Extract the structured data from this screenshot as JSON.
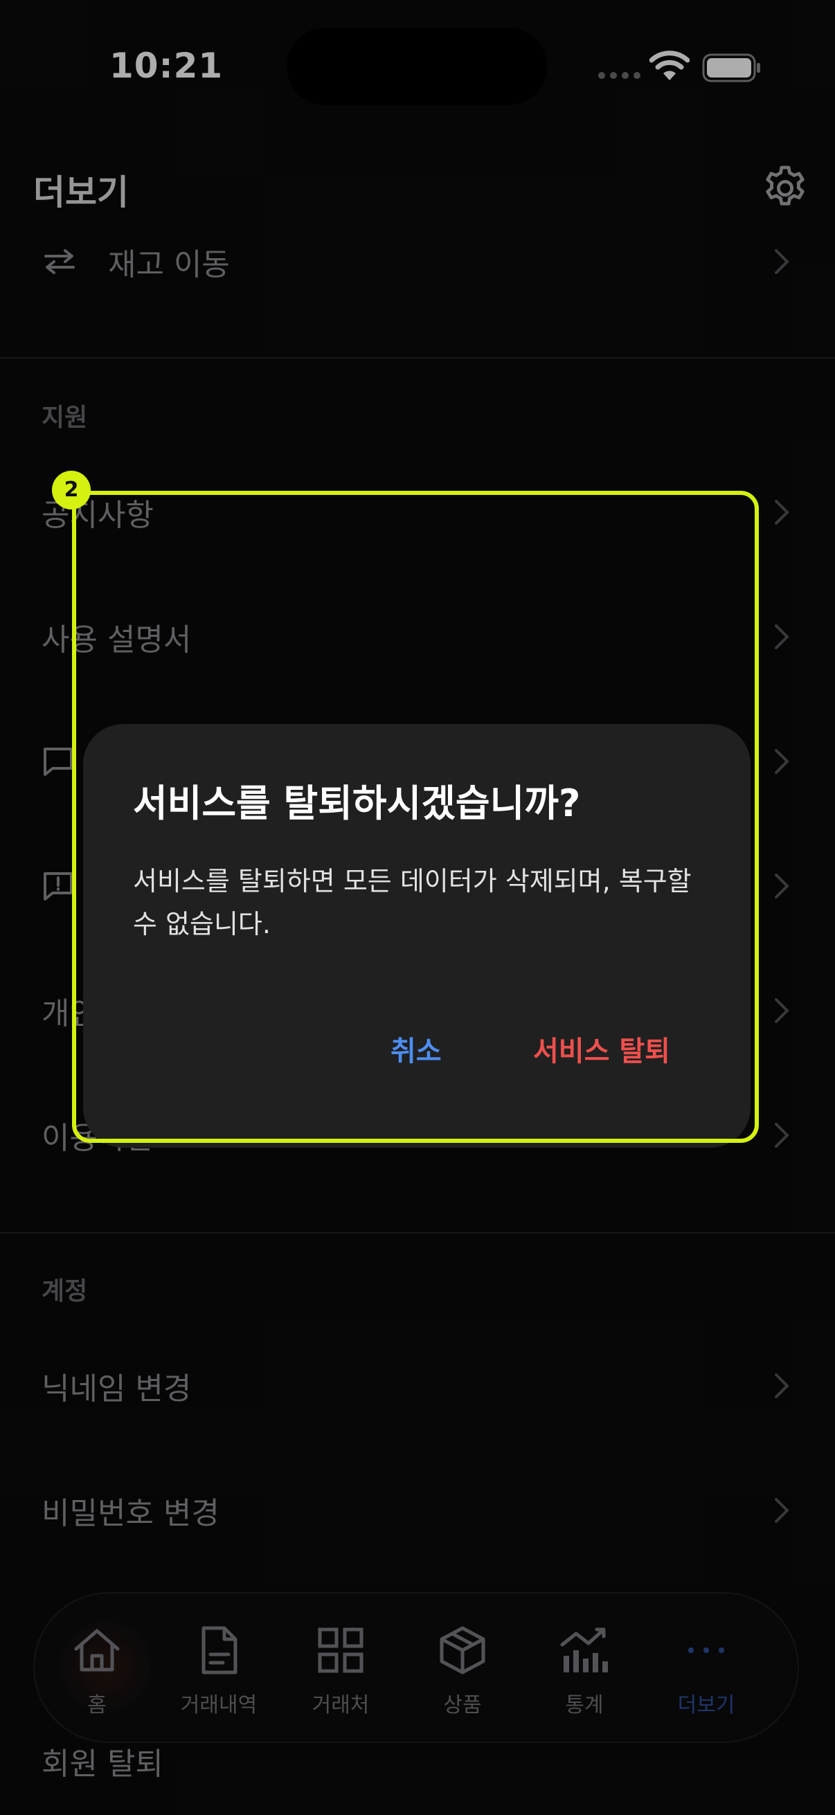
{
  "status": {
    "time": "10:21"
  },
  "header": {
    "title": "더보기"
  },
  "rows_top": [
    {
      "label": "재고 이동"
    }
  ],
  "support": {
    "section": "지원",
    "items": [
      {
        "label": "공지사항"
      },
      {
        "label": "사용 설명서"
      },
      {
        "label": ""
      },
      {
        "label": ""
      },
      {
        "label": "개인정보 처리방침"
      },
      {
        "label": "이용약관"
      }
    ]
  },
  "account": {
    "section": "계정",
    "items": [
      {
        "label": "닉네임 변경"
      },
      {
        "label": "비밀번호 변경"
      }
    ],
    "withdraw_label": "회원 탈퇴"
  },
  "dialog": {
    "title": "서비스를 탈퇴하시겠습니까?",
    "message": "서비스를 탈퇴하면 모든 데이터가 삭제되며, 복구할 수 없습니다.",
    "cancel": "취소",
    "confirm": "서비스 탈퇴"
  },
  "highlight": {
    "badge": "2",
    "color": "#d4f10f"
  },
  "tabs": [
    {
      "label": "홈",
      "icon": "home-icon"
    },
    {
      "label": "거래내역",
      "icon": "document-icon"
    },
    {
      "label": "거래처",
      "icon": "grid-icon"
    },
    {
      "label": "상품",
      "icon": "box-icon"
    },
    {
      "label": "통계",
      "icon": "chart-icon"
    },
    {
      "label": "더보기",
      "icon": "more-icon"
    }
  ],
  "colors": {
    "accent": "#4d8ef2",
    "danger": "#f0504d",
    "active_tab": "#2f4e9c"
  }
}
